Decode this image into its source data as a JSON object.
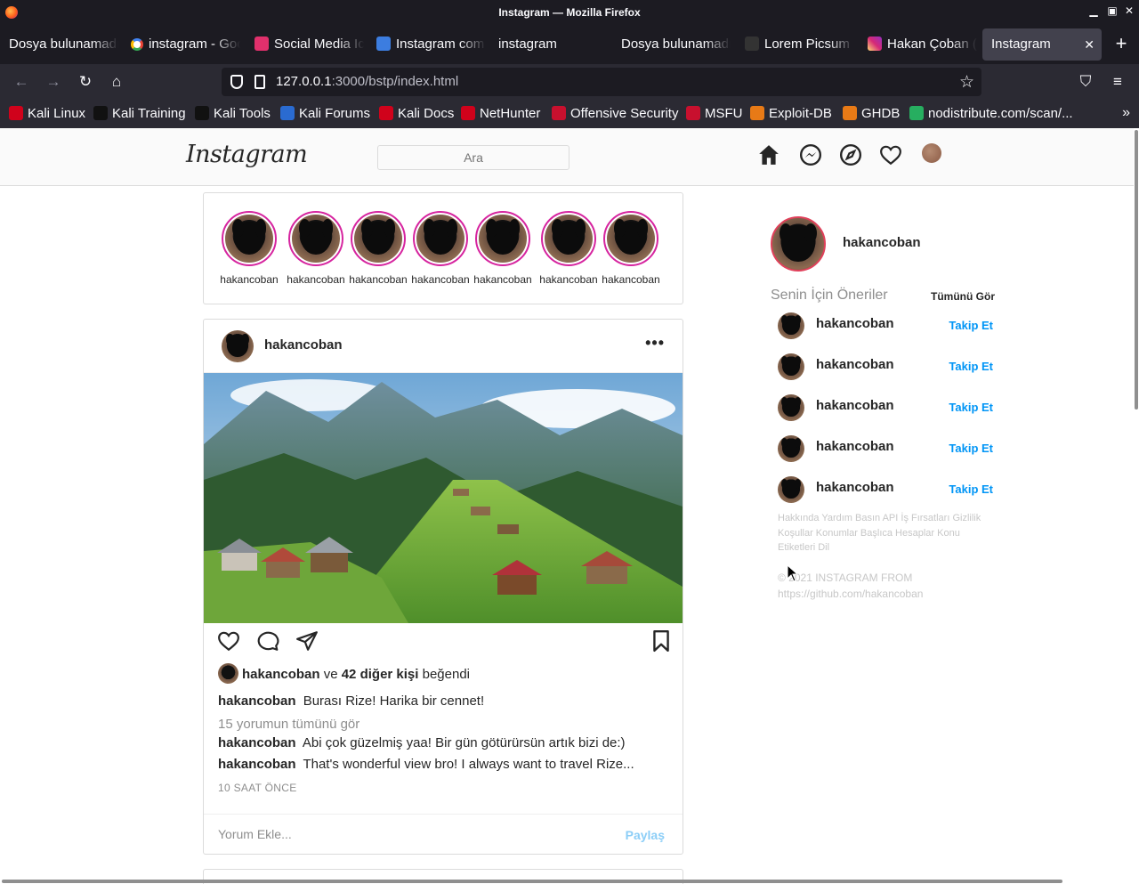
{
  "window": {
    "title": "Instagram — Mozilla Firefox"
  },
  "tabs": [
    {
      "label": "Dosya bulunamadı",
      "favicon_color": "#1c1b22"
    },
    {
      "label": "instagram - Google",
      "favicon_color": "#ffffff"
    },
    {
      "label": "Social Media Icons",
      "favicon_color": "#e1306c"
    },
    {
      "label": "Instagram com",
      "favicon_color": "#3c7de0"
    },
    {
      "label": "instagram",
      "favicon_color": "#1c1b22"
    },
    {
      "label": "Dosya bulunamadı",
      "favicon_color": "#1c1b22"
    },
    {
      "label": "Lorem Picsum",
      "favicon_color": "#333333"
    },
    {
      "label": "Hakan Çoban (",
      "favicon_color": "#d6249f"
    },
    {
      "label": "Instagram",
      "favicon_color": "#42414d",
      "active": true
    }
  ],
  "url": {
    "host": "127.0.0.1",
    "path": ":3000/bstp/index.html"
  },
  "bookmarks": [
    {
      "label": "Kali Linux",
      "icon_color": "#d0021b"
    },
    {
      "label": "Kali Training",
      "icon_color": "#000000"
    },
    {
      "label": "Kali Tools",
      "icon_color": "#000000"
    },
    {
      "label": "Kali Forums",
      "icon_color": "#2a6bd1"
    },
    {
      "label": "Kali Docs",
      "icon_color": "#d0021b"
    },
    {
      "label": "NetHunter",
      "icon_color": "#d0021b"
    },
    {
      "label": "Offensive Security",
      "icon_color": "#c8102e"
    },
    {
      "label": "MSFU",
      "icon_color": "#c8102e"
    },
    {
      "label": "Exploit-DB",
      "icon_color": "#e87a16"
    },
    {
      "label": "GHDB",
      "icon_color": "#e87a16"
    },
    {
      "label": "nodistribute.com/scan/...",
      "icon_color": "#27ae60"
    }
  ],
  "ig": {
    "logo": "Instagram",
    "search_placeholder": "Ara",
    "stories": [
      "hakancoban",
      "hakancoban",
      "hakancoban",
      "hakancoban",
      "hakancoban",
      "hakancoban",
      "hakancoban"
    ],
    "post": {
      "username": "hakancoban",
      "likes": {
        "user": "hakancoban",
        "mid": "ve",
        "count": "42 diğer kişi",
        "suffix": "beğendi"
      },
      "caption": {
        "user": "hakancoban",
        "text": "Burası Rize! Harika bir cennet!"
      },
      "view_all_comments": "15 yorumun tümünü gör",
      "comments": [
        {
          "user": "hakancoban",
          "text": "Abi çok güzelmiş yaa! Bir gün götürürsün artık bizi de:)"
        },
        {
          "user": "hakancoban",
          "text": "That's wonderful view bro! I always want to travel Rize..."
        }
      ],
      "time": "10 SAAT ÖNCE",
      "comment_placeholder": "Yorum Ekle...",
      "share_label": "Paylaş"
    },
    "sidebar": {
      "username": "hakancoban",
      "suggestions_title": "Senin İçin Öneriler",
      "see_all": "Tümünü Gör",
      "suggestions": [
        {
          "name": "hakancoban",
          "action": "Takip Et"
        },
        {
          "name": "hakancoban",
          "action": "Takip Et"
        },
        {
          "name": "hakancoban",
          "action": "Takip Et"
        },
        {
          "name": "hakancoban",
          "action": "Takip Et"
        },
        {
          "name": "hakancoban",
          "action": "Takip Et"
        }
      ],
      "footer_links": "Hakkında Yardım Basın API İş Fırsatları Gizlilik Koşullar Konumlar Başlıca Hesaplar Konu Etiketleri Dil",
      "copyright": "© 2021 INSTAGRAM FROM https://github.com/hakancoban"
    }
  }
}
